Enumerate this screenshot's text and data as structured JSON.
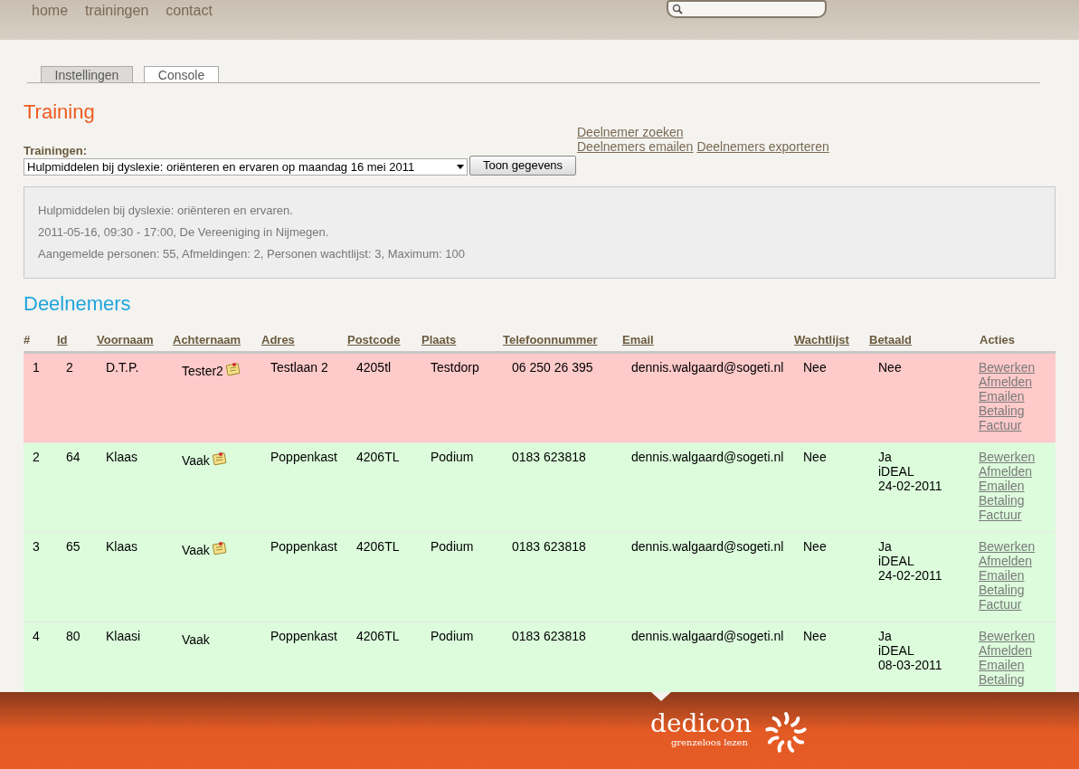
{
  "nav": [
    "home",
    "trainingen",
    "contact"
  ],
  "tabs": [
    {
      "label": "Instellingen",
      "selected": false
    },
    {
      "label": "Console",
      "selected": true
    }
  ],
  "training": {
    "title": "Training",
    "select_label": "Trainingen:",
    "select_value": "Hulpmiddelen bij dyslexie: oriënteren en ervaren op maandag 16 mei 2011",
    "button": "Toon gegevens",
    "links": [
      [
        "Deelnemer zoeken"
      ],
      [
        "Deelnemers emailen",
        "Deelnemers exporteren"
      ]
    ]
  },
  "info": [
    "Hulpmiddelen bij dyslexie: oriënteren en ervaren.",
    "2011-05-16, 09:30 - 17:00, De Vereeniging in Nijmegen.",
    "Aangemelde personen: 55, Afmeldingen: 2, Personen wachtlijst: 3, Maximum: 100"
  ],
  "participants": {
    "title": "Deelnemers",
    "columns": [
      {
        "label": "#",
        "sortable": false
      },
      {
        "label": "Id",
        "sortable": true
      },
      {
        "label": "Voornaam",
        "sortable": true
      },
      {
        "label": "Achternaam",
        "sortable": true
      },
      {
        "label": "Adres",
        "sortable": true
      },
      {
        "label": "Postcode",
        "sortable": true
      },
      {
        "label": "Plaats",
        "sortable": true
      },
      {
        "label": "Telefoonnummer",
        "sortable": true
      },
      {
        "label": "Email",
        "sortable": true
      },
      {
        "label": "Wachtlijst",
        "sortable": true
      },
      {
        "label": "Betaald",
        "sortable": true
      },
      {
        "label": "Acties",
        "sortable": false
      }
    ],
    "rows": [
      {
        "color": "#ffcaca",
        "nr": "1",
        "id": "2",
        "first": "D.T.P.",
        "last": "Tester2",
        "note": true,
        "address": "Testlaan 2",
        "postcode": "4205tl",
        "city": "Testdorp",
        "phone": "06 250 26 395",
        "email": "dennis.walgaard@sogeti.nl",
        "waitlist": "Nee",
        "paid": [
          "Nee"
        ],
        "actions": [
          "Bewerken",
          "Afmelden",
          "Emailen",
          "Betaling",
          "Factuur"
        ]
      },
      {
        "color": "#dcfcdc",
        "nr": "2",
        "id": "64",
        "first": "Klaas",
        "last": "Vaak",
        "note": true,
        "address": "Poppenkast",
        "postcode": "4206TL",
        "city": "Podium",
        "phone": "0183 623818",
        "email": "dennis.walgaard@sogeti.nl",
        "waitlist": "Nee",
        "paid": [
          "Ja",
          "iDEAL",
          "24-02-2011"
        ],
        "actions": [
          "Bewerken",
          "Afmelden",
          "Emailen",
          "Betaling",
          "Factuur"
        ]
      },
      {
        "color": "#dcfcdc",
        "nr": "3",
        "id": "65",
        "first": "Klaas",
        "last": "Vaak",
        "note": true,
        "address": "Poppenkast",
        "postcode": "4206TL",
        "city": "Podium",
        "phone": "0183 623818",
        "email": "dennis.walgaard@sogeti.nl",
        "waitlist": "Nee",
        "paid": [
          "Ja",
          "iDEAL",
          "24-02-2011"
        ],
        "actions": [
          "Bewerken",
          "Afmelden",
          "Emailen",
          "Betaling",
          "Factuur"
        ]
      },
      {
        "color": "#dcfcdc",
        "nr": "4",
        "id": "80",
        "first": "Klaasi",
        "last": "Vaak",
        "note": false,
        "address": "Poppenkast",
        "postcode": "4206TL",
        "city": "Podium",
        "phone": "0183 623818",
        "email": "dennis.walgaard@sogeti.nl",
        "waitlist": "Nee",
        "paid": [
          "Ja",
          "iDEAL",
          "08-03-2011"
        ],
        "actions": [
          "Bewerken",
          "Afmelden",
          "Emailen",
          "Betaling"
        ]
      }
    ]
  },
  "footer": {
    "brand": "dedicon",
    "tagline": "grenzeloos lezen"
  }
}
